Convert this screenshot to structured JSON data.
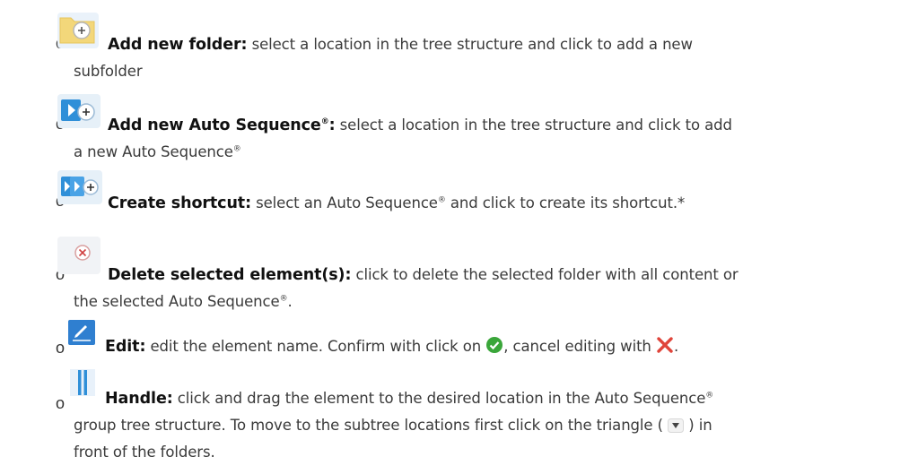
{
  "items": [
    {
      "icon": "folder-add-icon",
      "term": "Add new folder:",
      "desc_1": "select a location in the tree structure and click to add a new",
      "desc_2": "subfolder"
    },
    {
      "icon": "auto-sequence-add-icon",
      "term": "Add new Auto Sequence",
      "term_reg": "®",
      "term_colon": ":",
      "desc_1": "select a location in the tree structure and click to add",
      "desc_2": "a new Auto Sequence",
      "desc_2_reg": "®"
    },
    {
      "icon": "shortcut-add-icon",
      "term": "Create shortcut:",
      "desc_a": "select an Auto Sequence",
      "desc_reg": "®",
      "desc_b": "and click to create its shortcut.*"
    },
    {
      "icon": "delete-element-icon",
      "term": "Delete selected element(s):",
      "desc_1": "click to delete the selected folder with all content or",
      "desc_2a": "the selected Auto Sequence",
      "desc_2_reg": "®",
      "desc_2b": "."
    },
    {
      "icon": "edit-pencil-icon",
      "term": "Edit:",
      "desc_a": "edit the element name. Confirm with click on",
      "desc_b": ", cancel editing with",
      "desc_c": "."
    },
    {
      "icon": "drag-handle-icon",
      "term": "Handle:",
      "desc_1a": "click and drag the element to the desired location in the Auto Sequence",
      "desc_1_reg": "®",
      "desc_2a": "group tree structure. To move to the subtree locations first click on the triangle (",
      "desc_2b": ") in",
      "desc_3": "front of the folders."
    }
  ],
  "bullet": "o",
  "colors": {
    "text": "#3a3a3a",
    "term": "#111111",
    "confirm_green": "#3aa63a",
    "cancel_red": "#e0443a",
    "icon_blue": "#2f8fd8",
    "folder_yellow": "#f3d77a"
  }
}
